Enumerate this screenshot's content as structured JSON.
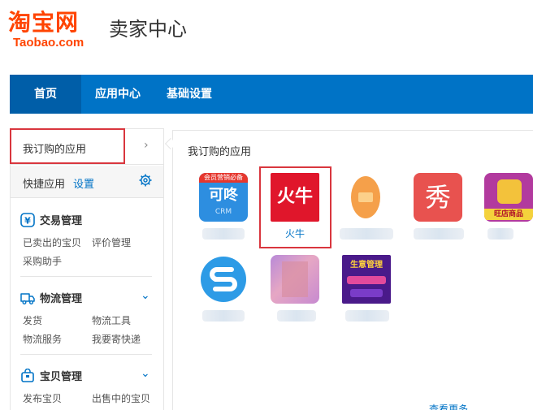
{
  "header": {
    "logo_cn": "淘宝网",
    "logo_en": "Taobao.com",
    "title": "卖家中心"
  },
  "nav": {
    "items": [
      {
        "label": "首页",
        "active": true
      },
      {
        "label": "应用中心",
        "active": false
      },
      {
        "label": "基础设置",
        "active": false
      }
    ]
  },
  "sidebar": {
    "subscribed_label": "我订购的应用",
    "quick_label": "快捷应用",
    "quick_setting": "设置",
    "sections": [
      {
        "title": "交易管理",
        "icon": "yen-icon",
        "links": [
          "已卖出的宝贝",
          "评价管理",
          "采购助手"
        ]
      },
      {
        "title": "物流管理",
        "icon": "truck-icon",
        "links": [
          "发货",
          "物流工具",
          "物流服务",
          "我要寄快递"
        ]
      },
      {
        "title": "宝贝管理",
        "icon": "bag-icon",
        "links": [
          "发布宝贝",
          "出售中的宝贝"
        ]
      }
    ]
  },
  "main": {
    "title": "我订购的应用",
    "apps": [
      {
        "tile_text": "可咚",
        "badge": "会员营销必备",
        "sub": "CRM",
        "name": ""
      },
      {
        "tile_text": "火牛",
        "name": "火牛"
      },
      {
        "tile_text": "",
        "name": ""
      },
      {
        "tile_text": "秀",
        "name": ""
      },
      {
        "tile_text": "旺店商品",
        "name": ""
      },
      {
        "tile_text": "",
        "name": ""
      },
      {
        "tile_text": "",
        "name": ""
      },
      {
        "tile_text": "生意管理",
        "name": ""
      }
    ],
    "more_label": "查看更多"
  },
  "colors": {
    "brand_orange": "#ff4400",
    "nav_blue": "#0073c6",
    "nav_active": "#005ea8",
    "highlight_red": "#d9363e",
    "link_blue": "#0073c6"
  }
}
